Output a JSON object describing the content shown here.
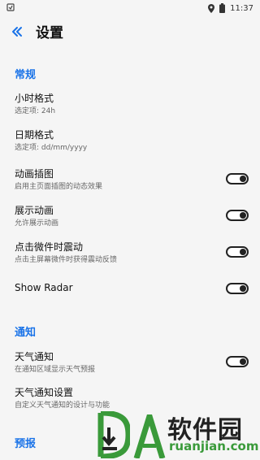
{
  "status_bar": {
    "time": "11:37"
  },
  "app_bar": {
    "title": "设置"
  },
  "sections": {
    "general": {
      "header": "常规"
    },
    "notifications": {
      "header": "通知"
    },
    "forecast": {
      "header": "预报"
    }
  },
  "settings": {
    "hour_format": {
      "title": "小时格式",
      "subtitle": "选定项: 24h"
    },
    "date_format": {
      "title": "日期格式",
      "subtitle": "选定项: dd/mm/yyyy"
    },
    "animated_illustration": {
      "title": "动画插图",
      "subtitle": "启用主页面插图的动态效果",
      "enabled": true
    },
    "show_animation": {
      "title": "展示动画",
      "subtitle": "允许展示动画",
      "enabled": true
    },
    "tap_vibration": {
      "title": "点击微件时震动",
      "subtitle": "点击主屏幕微件时获得震动反馈",
      "enabled": true
    },
    "show_radar": {
      "title": "Show Radar",
      "enabled": true
    },
    "weather_notification": {
      "title": "天气通知",
      "subtitle": "在通知区域显示天气预报",
      "enabled": true
    },
    "weather_notification_settings": {
      "title": "天气通知设置",
      "subtitle": "自定义天气通知的设计与功能"
    }
  },
  "watermark": {
    "text_cn": "软件园",
    "text_en": "ruanjian.com"
  },
  "colors": {
    "accent": "#1a73e8",
    "background": "#f5f5f5",
    "toggle": "#222222",
    "watermark_green": "#3a9a3a"
  }
}
